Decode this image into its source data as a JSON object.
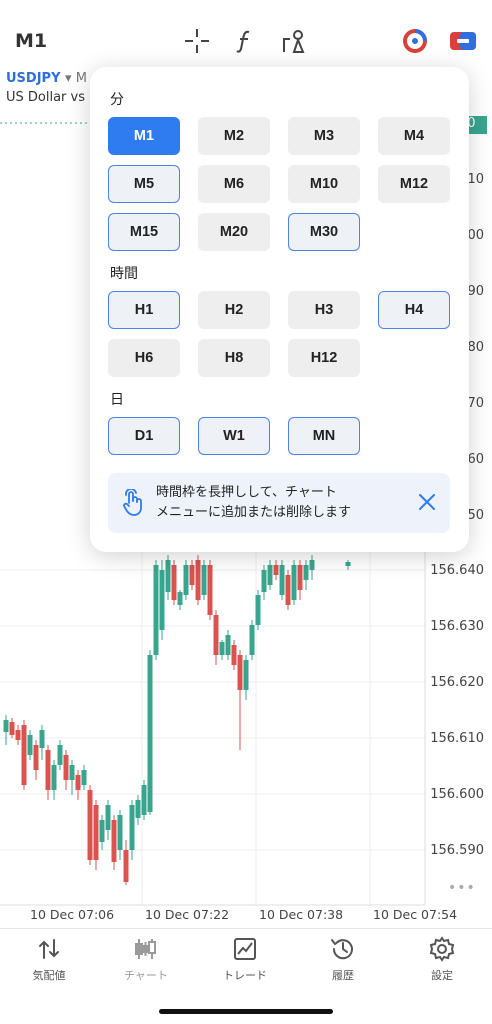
{
  "topbar": {
    "timeframe": "M1",
    "icons": [
      "crosshair-icon",
      "function-icon",
      "objects-icon",
      "indicator-icon",
      "trade-icon"
    ]
  },
  "chart": {
    "symbol": "USDJPY",
    "symbol_suffix": "▾ M",
    "description": "US Dollar vs .",
    "price_labels": [
      "20",
      "10",
      "00",
      "90",
      "80",
      "70",
      "60",
      "50",
      "156.640",
      "156.630",
      "156.620",
      "156.610",
      "156.600",
      "156.590"
    ],
    "time_labels": [
      "10 Dec 07:06",
      "10 Dec 07:22",
      "10 Dec 07:38",
      "10 Dec 07:54"
    ],
    "colors": {
      "up": "#3aa58e",
      "down": "#d9534f"
    }
  },
  "popup": {
    "sections": {
      "minutes": "分",
      "hours": "時間",
      "days": "日"
    },
    "minutes": [
      "M1",
      "M2",
      "M3",
      "M4",
      "M5",
      "M6",
      "M10",
      "M12",
      "M15",
      "M20",
      "M30"
    ],
    "hours": [
      "H1",
      "H2",
      "H3",
      "H4",
      "H6",
      "H8",
      "H12"
    ],
    "days": [
      "D1",
      "W1",
      "MN"
    ],
    "selected": "M1",
    "hint_line1": "時間枠を長押しして、チャート",
    "hint_line2": "メニューに追加または削除します"
  },
  "nav": {
    "items": [
      {
        "label": "気配値",
        "icon": "quotes-icon"
      },
      {
        "label": "チャート",
        "icon": "chart-icon"
      },
      {
        "label": "トレード",
        "icon": "trade-line-icon"
      },
      {
        "label": "履歴",
        "icon": "history-icon"
      },
      {
        "label": "設定",
        "icon": "settings-icon"
      }
    ]
  }
}
